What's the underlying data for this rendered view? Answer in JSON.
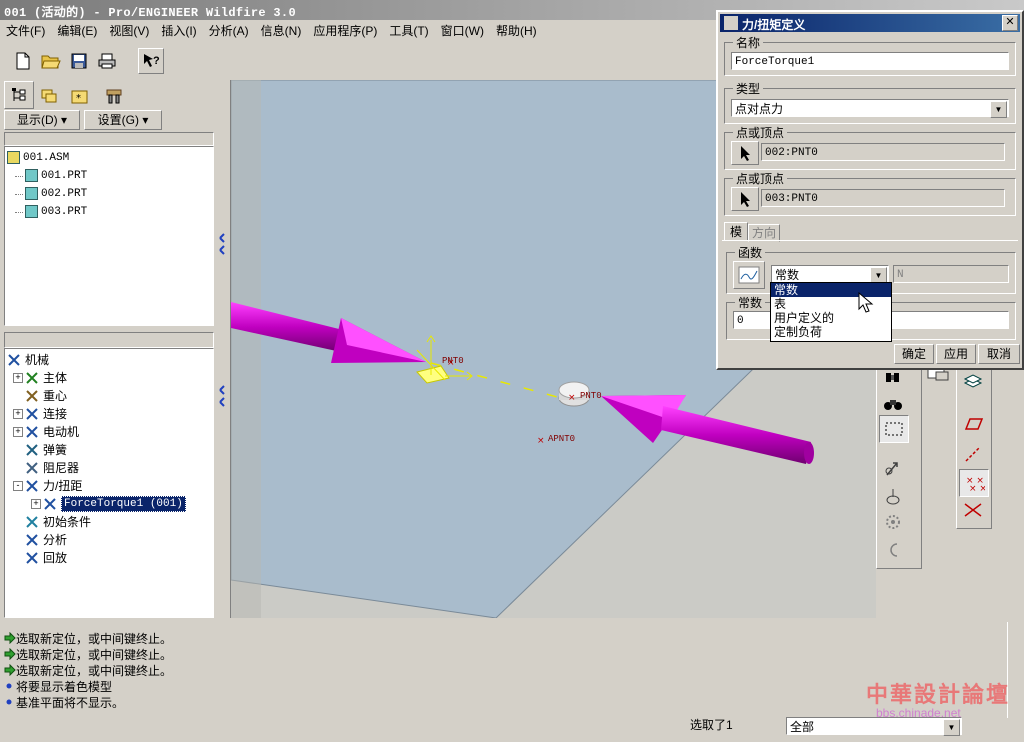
{
  "window": {
    "title": "001 (活动的) - Pro/ENGINEER Wildfire 3.0"
  },
  "menu": [
    "文件(F)",
    "编辑(E)",
    "视图(V)",
    "插入(I)",
    "分析(A)",
    "信息(N)",
    "应用程序(P)",
    "工具(T)",
    "窗口(W)",
    "帮助(H)"
  ],
  "toolbar": {
    "icons": [
      "new-file-icon",
      "open-folder-icon",
      "save-icon",
      "print-icon",
      "context-help-icon"
    ]
  },
  "left_panel": {
    "tab_icons": [
      "model-tree-tab-icon",
      "layers-tab-icon",
      "favorites-tab-icon",
      "connections-tab-icon"
    ],
    "display_button": "显示(D) ▾",
    "settings_button": "设置(G) ▾",
    "model_tree": [
      {
        "label": "001.ASM",
        "indent": 0
      },
      {
        "label": "001.PRT",
        "indent": 1
      },
      {
        "label": "002.PRT",
        "indent": 1
      },
      {
        "label": "003.PRT",
        "indent": 1
      }
    ],
    "mech_tree": [
      {
        "label": "机械",
        "indent": 0,
        "expander": ""
      },
      {
        "label": "主体",
        "indent": 1,
        "expander": "+"
      },
      {
        "label": "重心",
        "indent": 1,
        "expander": ""
      },
      {
        "label": "连接",
        "indent": 1,
        "expander": "+"
      },
      {
        "label": "电动机",
        "indent": 1,
        "expander": "+"
      },
      {
        "label": "弹簧",
        "indent": 1,
        "expander": ""
      },
      {
        "label": "阻尼器",
        "indent": 1,
        "expander": ""
      },
      {
        "label": "力/扭距",
        "indent": 1,
        "expander": "-"
      },
      {
        "label": "ForceTorque1 (001)",
        "indent": 2,
        "expander": "+",
        "selected": true
      },
      {
        "label": "初始条件",
        "indent": 1,
        "expander": ""
      },
      {
        "label": "分析",
        "indent": 1,
        "expander": ""
      },
      {
        "label": "回放",
        "indent": 1,
        "expander": ""
      }
    ]
  },
  "viewport": {
    "labels": {
      "pnt_left": "PNT0",
      "pnt_right": "PNT0",
      "apnt": "APNT0"
    },
    "colors": {
      "arrow": "#c000c0",
      "plane": "#a9bccc",
      "background": "#cbcbc6"
    }
  },
  "dialog": {
    "title": "力/扭矩定义",
    "name_label": "名称",
    "name_value": "ForceTorque1",
    "type_label": "类型",
    "type_value": "点对点力",
    "point1_label": "点或顶点",
    "point1_value": "002:PNT0",
    "point2_label": "点或顶点",
    "point2_value": "003:PNT0",
    "tabs": [
      "模",
      "方向"
    ],
    "function_label": "函数",
    "function_value": "常数",
    "unit_value": "N",
    "constant_label": "常数",
    "constant_value": "0",
    "dropdown_options": [
      "常数",
      "表",
      "用户定义的",
      "定制负荷"
    ],
    "dropdown_selected": 0,
    "buttons": {
      "ok": "确定",
      "apply": "应用",
      "cancel": "取消"
    }
  },
  "messages": [
    {
      "text": "选取新定位，或中间键终止。",
      "type": "arrow"
    },
    {
      "text": "选取新定位，或中间键终止。",
      "type": "arrow"
    },
    {
      "text": "选取新定位，或中间键终止。",
      "type": "arrow"
    },
    {
      "text": "将要显示着色模型",
      "type": "bullet"
    },
    {
      "text": "基准平面将不显示。",
      "type": "bullet"
    }
  ],
  "status": {
    "selected": "选取了1",
    "filter": "全部"
  },
  "watermark": {
    "line1": "中華設計論壇",
    "line2": "bbs.chinade.net"
  }
}
